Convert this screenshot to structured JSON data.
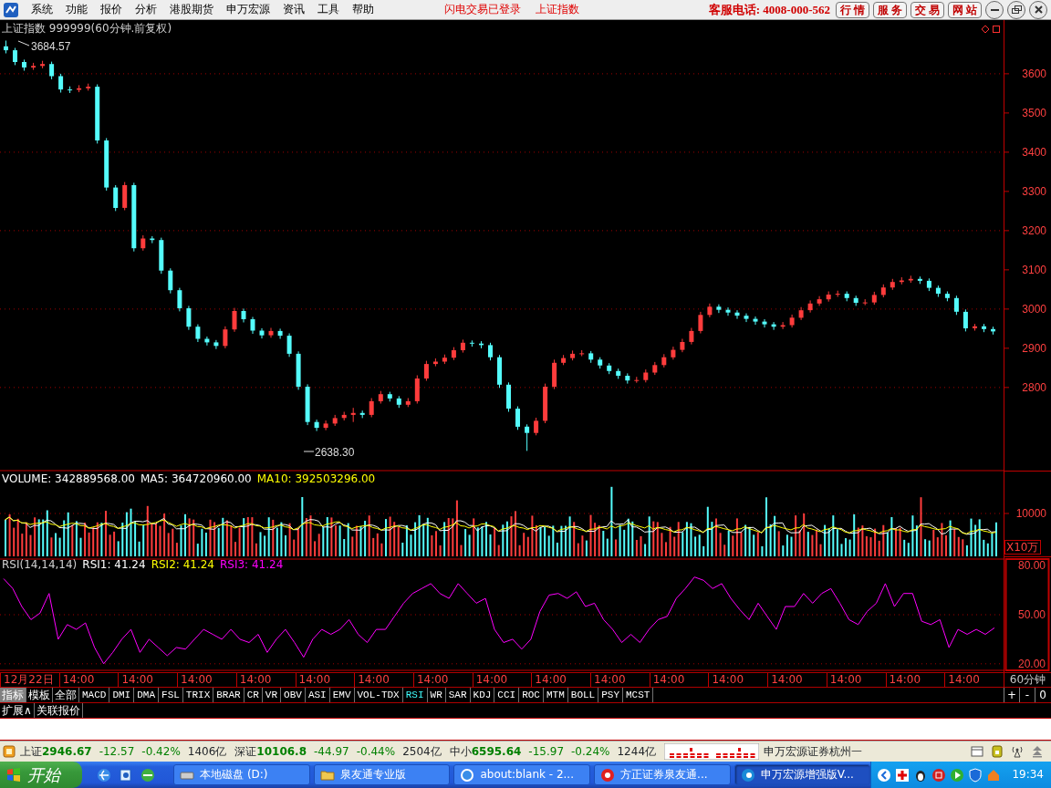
{
  "menu": [
    "系统",
    "功能",
    "报价",
    "分析",
    "港股期货",
    "申万宏源",
    "资讯",
    "工具",
    "帮助"
  ],
  "notices": [
    "闪电交易已登录",
    "上证指数"
  ],
  "hotline": "客服电话: 4008-000-562",
  "top_buttons": [
    "行 情",
    "服 务",
    "交 易",
    "网 站"
  ],
  "price_panel": {
    "title": "上证指数 999999(60分钟.前复权)",
    "high_label": "3684.57",
    "low_label": "2638.30",
    "chart_data": {
      "type": "candlestick",
      "ylim": [
        2588,
        3737
      ],
      "yticks": [
        3600,
        3500,
        3400,
        3300,
        3200,
        3100,
        3000,
        2900,
        2800
      ],
      "ohlc": [
        [
          3670,
          3684.57,
          3652,
          3660
        ],
        [
          3660,
          3666,
          3622,
          3630
        ],
        [
          3630,
          3636,
          3608,
          3616
        ],
        [
          3616,
          3628,
          3610,
          3620
        ],
        [
          3620,
          3633,
          3614,
          3625
        ],
        [
          3625,
          3631,
          3586,
          3594
        ],
        [
          3594,
          3600,
          3552,
          3560
        ],
        [
          3560,
          3568,
          3551,
          3559
        ],
        [
          3559,
          3571,
          3553,
          3563
        ],
        [
          3563,
          3575,
          3557,
          3567
        ],
        [
          3567,
          3573,
          3422,
          3430
        ],
        [
          3430,
          3436,
          3302,
          3310
        ],
        [
          3310,
          3316,
          3250,
          3258
        ],
        [
          3258,
          3324,
          3252,
          3316
        ],
        [
          3316,
          3322,
          3147,
          3155
        ],
        [
          3155,
          3188,
          3149,
          3180
        ],
        [
          3180,
          3186,
          3168,
          3176
        ],
        [
          3176,
          3182,
          3090,
          3098
        ],
        [
          3098,
          3104,
          3040,
          3048
        ],
        [
          3048,
          3054,
          2994,
          3002
        ],
        [
          3002,
          3008,
          2947,
          2955
        ],
        [
          2955,
          2961,
          2916,
          2924
        ],
        [
          2924,
          2930,
          2907,
          2915
        ],
        [
          2915,
          2921,
          2898,
          2906
        ],
        [
          2906,
          2956,
          2900,
          2948
        ],
        [
          2948,
          3003,
          2942,
          2995
        ],
        [
          2995,
          3001,
          2966,
          2974
        ],
        [
          2974,
          2980,
          2937,
          2945
        ],
        [
          2945,
          2951,
          2925,
          2933
        ],
        [
          2933,
          2952,
          2927,
          2944
        ],
        [
          2944,
          2950,
          2924,
          2932
        ],
        [
          2932,
          2938,
          2878,
          2886
        ],
        [
          2886,
          2892,
          2794,
          2802
        ],
        [
          2802,
          2808,
          2704,
          2712
        ],
        [
          2712,
          2718,
          2689,
          2697
        ],
        [
          2697,
          2716,
          2691,
          2708
        ],
        [
          2708,
          2730,
          2702,
          2722
        ],
        [
          2722,
          2738,
          2716,
          2730
        ],
        [
          2730,
          2748,
          2712,
          2735
        ],
        [
          2735,
          2741,
          2722,
          2730
        ],
        [
          2730,
          2773,
          2724,
          2765
        ],
        [
          2765,
          2791,
          2759,
          2783
        ],
        [
          2783,
          2789,
          2764,
          2772
        ],
        [
          2772,
          2778,
          2748,
          2756
        ],
        [
          2756,
          2773,
          2750,
          2765
        ],
        [
          2765,
          2831,
          2759,
          2823
        ],
        [
          2823,
          2868,
          2817,
          2860
        ],
        [
          2860,
          2874,
          2854,
          2866
        ],
        [
          2866,
          2884,
          2860,
          2876
        ],
        [
          2876,
          2903,
          2870,
          2895
        ],
        [
          2895,
          2922,
          2889,
          2914
        ],
        [
          2914,
          2920,
          2904,
          2912
        ],
        [
          2912,
          2918,
          2900,
          2908
        ],
        [
          2908,
          2914,
          2869,
          2877
        ],
        [
          2877,
          2883,
          2799,
          2807
        ],
        [
          2807,
          2813,
          2738,
          2746
        ],
        [
          2746,
          2752,
          2692,
          2700
        ],
        [
          2700,
          2706,
          2638.3,
          2684
        ],
        [
          2684,
          2723,
          2678,
          2715
        ],
        [
          2715,
          2810,
          2709,
          2802
        ],
        [
          2802,
          2871,
          2796,
          2863
        ],
        [
          2863,
          2883,
          2857,
          2875
        ],
        [
          2875,
          2894,
          2869,
          2886
        ],
        [
          2886,
          2895,
          2880,
          2887
        ],
        [
          2887,
          2893,
          2863,
          2871
        ],
        [
          2871,
          2877,
          2848,
          2856
        ],
        [
          2856,
          2862,
          2834,
          2842
        ],
        [
          2842,
          2848,
          2822,
          2830
        ],
        [
          2830,
          2836,
          2810,
          2818
        ],
        [
          2818,
          2827,
          2812,
          2819
        ],
        [
          2819,
          2846,
          2813,
          2838
        ],
        [
          2838,
          2865,
          2832,
          2857
        ],
        [
          2857,
          2885,
          2851,
          2877
        ],
        [
          2877,
          2904,
          2871,
          2896
        ],
        [
          2896,
          2924,
          2890,
          2916
        ],
        [
          2916,
          2952,
          2910,
          2944
        ],
        [
          2944,
          2993,
          2938,
          2985
        ],
        [
          2985,
          3014,
          2979,
          3006
        ],
        [
          3006,
          3012,
          2990,
          2998
        ],
        [
          2998,
          3004,
          2983,
          2991
        ],
        [
          2991,
          2997,
          2975,
          2983
        ],
        [
          2983,
          2989,
          2967,
          2975
        ],
        [
          2975,
          2981,
          2960,
          2968
        ],
        [
          2968,
          2974,
          2953,
          2961
        ],
        [
          2961,
          2967,
          2947,
          2955
        ],
        [
          2955,
          2967,
          2949,
          2959
        ],
        [
          2959,
          2986,
          2953,
          2978
        ],
        [
          2978,
          3005,
          2972,
          2997
        ],
        [
          2997,
          3022,
          2991,
          3014
        ],
        [
          3014,
          3033,
          3008,
          3025
        ],
        [
          3025,
          3045,
          3019,
          3037
        ],
        [
          3037,
          3047,
          3031,
          3039
        ],
        [
          3039,
          3045,
          3020,
          3028
        ],
        [
          3028,
          3034,
          3008,
          3016
        ],
        [
          3016,
          3025,
          3010,
          3017
        ],
        [
          3017,
          3044,
          3011,
          3036
        ],
        [
          3036,
          3063,
          3030,
          3055
        ],
        [
          3055,
          3077,
          3049,
          3069
        ],
        [
          3069,
          3081,
          3063,
          3073
        ],
        [
          3073,
          3085,
          3067,
          3077
        ],
        [
          3077,
          3083,
          3064,
          3072
        ],
        [
          3072,
          3078,
          3046,
          3054
        ],
        [
          3054,
          3060,
          3031,
          3039
        ],
        [
          3039,
          3045,
          3020,
          3028
        ],
        [
          3028,
          3034,
          2985,
          2993
        ],
        [
          2993,
          2999,
          2943,
          2951
        ],
        [
          2951,
          2962,
          2945,
          2956
        ],
        [
          2956,
          2962,
          2941,
          2949
        ],
        [
          2949,
          2955,
          2935,
          2943
        ]
      ]
    }
  },
  "volume_panel": {
    "volume": "VOLUME: 342889568.00",
    "ma5": "MA5: 364720960.00",
    "ma10": "MA10: 392503296.00",
    "tick": "10000",
    "unit": "X10万"
  },
  "rsi_panel": {
    "name": "RSI(14,14,14)",
    "rsi1": "RSI1: 41.24",
    "rsi2": "RSI2: 41.24",
    "rsi3": "RSI3: 41.24",
    "chart_data": {
      "type": "line",
      "ylim": [
        16,
        84
      ],
      "yticks": [
        {
          "value": 80,
          "label": "80.00"
        },
        {
          "value": 50,
          "label": "50.00"
        },
        {
          "value": 20,
          "label": "20.00"
        }
      ],
      "series": [
        {
          "color": "#ff00ff",
          "values": [
            72,
            66,
            55,
            47,
            51,
            63,
            35,
            44,
            41,
            45,
            30,
            20,
            27,
            35,
            41,
            27,
            35,
            30,
            25,
            30,
            29,
            35,
            41,
            38,
            35,
            41,
            35,
            33,
            38,
            27,
            35,
            41,
            33,
            24,
            35,
            41,
            38,
            41,
            47,
            38,
            33,
            41,
            41,
            49,
            57,
            63,
            66,
            69,
            63,
            60,
            69,
            63,
            57,
            60,
            41,
            33,
            35,
            29,
            35,
            52,
            62,
            63,
            60,
            64,
            55,
            57,
            47,
            41,
            33,
            38,
            33,
            41,
            47,
            49,
            60,
            66,
            73,
            71,
            66,
            69,
            60,
            53,
            47,
            57,
            49,
            41,
            55,
            55,
            63,
            57,
            63,
            66,
            57,
            47,
            44,
            52,
            57,
            69,
            55,
            63,
            63,
            46,
            44,
            47,
            30,
            41,
            38,
            41,
            38,
            42
          ]
        }
      ]
    }
  },
  "time_axis": {
    "labels": [
      "12月22日",
      "14:00",
      "14:00",
      "14:00",
      "14:00",
      "14:00",
      "14:00",
      "14:00",
      "14:00",
      "14:00",
      "14:00",
      "14:00",
      "14:00",
      "14:00",
      "14:00",
      "14:00",
      "14:00"
    ],
    "period": "60分钟"
  },
  "mode_tabs": [
    {
      "label": "指标",
      "selected": true
    },
    {
      "label": "模板",
      "selected": false
    },
    {
      "label": "全部",
      "selected": false
    }
  ],
  "indicator_tabs": [
    {
      "label": "MACD",
      "selected": false
    },
    {
      "label": "DMI",
      "selected": false
    },
    {
      "label": "DMA",
      "selected": false
    },
    {
      "label": "FSL",
      "selected": false
    },
    {
      "label": "TRIX",
      "selected": false
    },
    {
      "label": "BRAR",
      "selected": false
    },
    {
      "label": "CR",
      "selected": false
    },
    {
      "label": "VR",
      "selected": false
    },
    {
      "label": "OBV",
      "selected": false
    },
    {
      "label": "ASI",
      "selected": false
    },
    {
      "label": "EMV",
      "selected": false
    },
    {
      "label": "VOL-TDX",
      "selected": false
    },
    {
      "label": "RSI",
      "selected": true
    },
    {
      "label": "WR",
      "selected": false
    },
    {
      "label": "SAR",
      "selected": false
    },
    {
      "label": "KDJ",
      "selected": false
    },
    {
      "label": "CCI",
      "selected": false
    },
    {
      "label": "ROC",
      "selected": false
    },
    {
      "label": "MTM",
      "selected": false
    },
    {
      "label": "BOLL",
      "selected": false
    },
    {
      "label": "PSY",
      "selected": false
    },
    {
      "label": "MCST",
      "selected": false
    }
  ],
  "zoom_buttons": [
    "+",
    "-",
    "0"
  ],
  "extra_tabs": [
    "扩展∧",
    "关联报价"
  ],
  "status_bar": {
    "indices": [
      {
        "name": "上证",
        "value": "2946.67",
        "change": "-12.57",
        "percent": "-0.42%",
        "amount": "1406亿"
      },
      {
        "name": "深证",
        "value": "10106.8",
        "change": "-44.97",
        "percent": "-0.44%",
        "amount": "2504亿"
      },
      {
        "name": "中小",
        "value": "6595.64",
        "change": "-15.97",
        "percent": "-0.24%",
        "amount": "1244亿"
      }
    ],
    "broker": "申万宏源证券杭州一"
  },
  "taskbar": {
    "start": "开始",
    "windows": [
      {
        "label": "本地磁盘 (D:)",
        "selected": false
      },
      {
        "label": "泉友通专业版",
        "selected": false
      },
      {
        "label": "about:blank - 2...",
        "selected": false
      },
      {
        "label": "方正证券泉友通...",
        "selected": false
      },
      {
        "label": "申万宏源增强版V...",
        "selected": true
      }
    ],
    "time": "19:34"
  }
}
